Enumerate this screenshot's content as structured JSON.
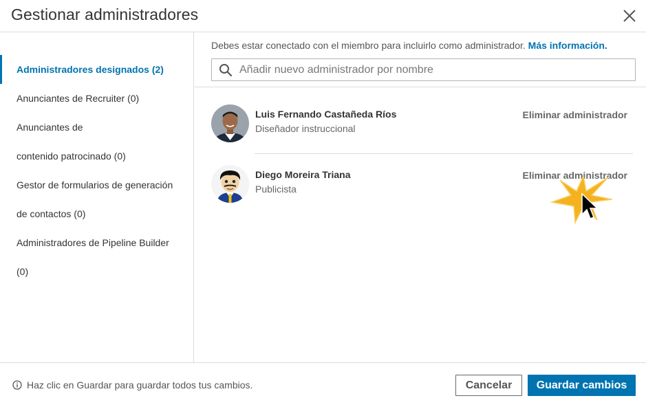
{
  "dialog": {
    "title": "Gestionar administradores",
    "close_icon": "close-icon"
  },
  "sidebar": {
    "items": [
      {
        "label": "Administradores designados (2)",
        "active": true
      },
      {
        "label": "Anunciantes de Recruiter (0)",
        "active": false
      },
      {
        "label": "Anunciantes de contenido patrocinado (0)",
        "active": false
      },
      {
        "label": "Gestor de formularios de generación de contactos (0)",
        "active": false
      },
      {
        "label": "Administradores de Pipeline Builder (0)",
        "active": false
      }
    ]
  },
  "main": {
    "notice_text": "Debes estar conectado con el miembro para incluirlo como administrador.",
    "notice_link": "Más información.",
    "search": {
      "placeholder": "Añadir nuevo administrador por nombre",
      "value": "",
      "icon": "search-icon"
    },
    "admins": [
      {
        "name": "Luis Fernando Castañeda Ríos",
        "role": "Diseñador instruccional",
        "action": "Eliminar administrador",
        "avatar": "photo-avatar"
      },
      {
        "name": "Diego Moreira Triana",
        "role": "Publicista",
        "action": "Eliminar administrador",
        "avatar": "cartoon-avatar"
      }
    ]
  },
  "footer": {
    "note": "Haz clic en Guardar para guardar todos tus cambios.",
    "info_icon": "info-icon",
    "cancel_label": "Cancelar",
    "save_label": "Guardar cambios"
  },
  "colors": {
    "accent": "#0073b1",
    "text": "#333333",
    "muted": "#666666",
    "divider": "#dcdcdc",
    "click_burst": "#f5b21f"
  }
}
